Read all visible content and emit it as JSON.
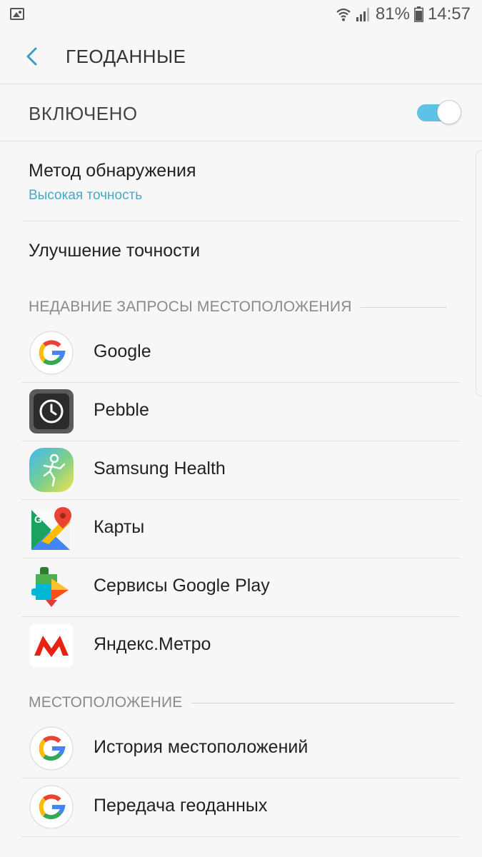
{
  "status_bar": {
    "battery": "81%",
    "time": "14:57",
    "icons": [
      "image-notification-icon",
      "wifi-icon",
      "signal-icon",
      "battery-icon"
    ]
  },
  "header": {
    "title": "ГЕОДАННЫЕ",
    "back_icon": "back-arrow-icon"
  },
  "master_switch": {
    "label": "ВКЛЮЧЕНО",
    "on": true,
    "accent": "#5ec2e6"
  },
  "settings": [
    {
      "title": "Метод обнаружения",
      "subtitle": "Высокая точность"
    },
    {
      "title": "Улучшение точности"
    }
  ],
  "recent_requests": {
    "header": "НЕДАВНИЕ ЗАПРОСЫ МЕСТОПОЛОЖЕНИЯ",
    "apps": [
      {
        "name": "Google",
        "icon": "google-icon"
      },
      {
        "name": "Pebble",
        "icon": "pebble-icon"
      },
      {
        "name": "Samsung Health",
        "icon": "samsung-health-icon"
      },
      {
        "name": "Карты",
        "icon": "google-maps-icon"
      },
      {
        "name": "Сервисы Google Play",
        "icon": "google-play-services-icon"
      },
      {
        "name": "Яндекс.Метро",
        "icon": "yandex-metro-icon"
      }
    ]
  },
  "location": {
    "header": "МЕСТОПОЛОЖЕНИЕ",
    "items": [
      {
        "name": "История местоположений",
        "icon": "google-icon"
      },
      {
        "name": "Передача геоданных",
        "icon": "google-icon"
      }
    ]
  },
  "colors": {
    "background": "#f7f7f7",
    "accent": "#4aa8c7",
    "section_text": "#8a8a8a"
  }
}
